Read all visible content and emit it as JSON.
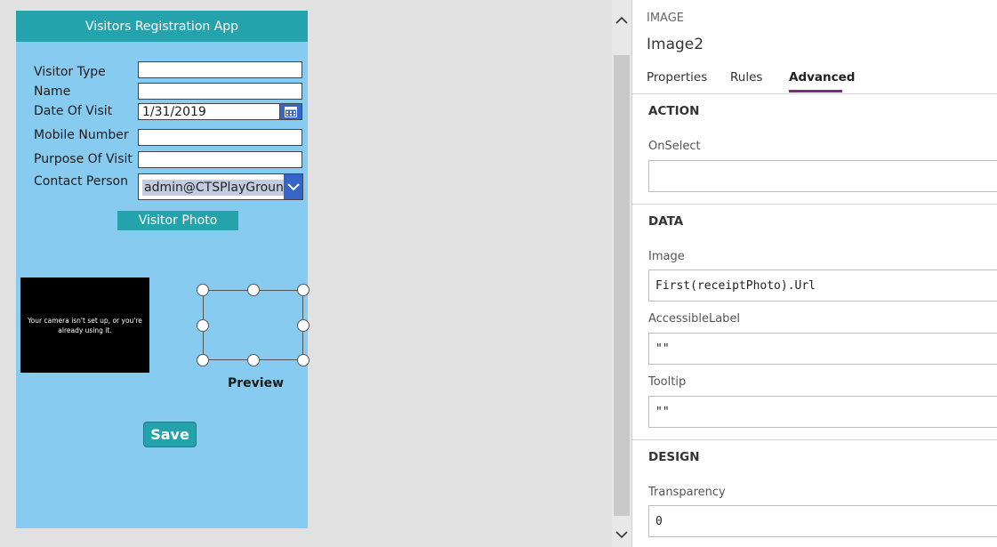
{
  "app": {
    "title": "Visitors Registration App",
    "fields": [
      {
        "label": "Visitor Type",
        "value": ""
      },
      {
        "label": "Name",
        "value": ""
      },
      {
        "label": "Date Of Visit",
        "value": "1/31/2019"
      },
      {
        "label": "Mobile Number",
        "value": ""
      },
      {
        "label": "Purpose Of Visit",
        "value": ""
      },
      {
        "label": "Contact Person",
        "value": "admin@CTSPlayGround"
      }
    ],
    "photo_button": "Visitor Photo",
    "camera_message": "Your camera isn't set up, or you're already using it.",
    "preview_label": "Preview",
    "save_button": "Save",
    "colors": {
      "header": "#25a3ad",
      "canvas": "#87cbf1",
      "accent": "#3565c8"
    }
  },
  "panel": {
    "control_type": "IMAGE",
    "control_name": "Image2",
    "tabs": [
      {
        "label": "Properties",
        "active": false
      },
      {
        "label": "Rules",
        "active": false
      },
      {
        "label": "Advanced",
        "active": true
      }
    ],
    "sections": {
      "action": {
        "title": "ACTION",
        "props": [
          {
            "label": "OnSelect",
            "value": ""
          }
        ]
      },
      "data": {
        "title": "DATA",
        "props": [
          {
            "label": "Image",
            "value": "First(receiptPhoto).Url"
          },
          {
            "label": "AccessibleLabel",
            "value": "\"\""
          },
          {
            "label": "Tooltip",
            "value": "\"\""
          }
        ]
      },
      "design": {
        "title": "DESIGN",
        "props": [
          {
            "label": "Transparency",
            "value": "0"
          }
        ]
      }
    },
    "accent_color": "#7b2a80"
  }
}
